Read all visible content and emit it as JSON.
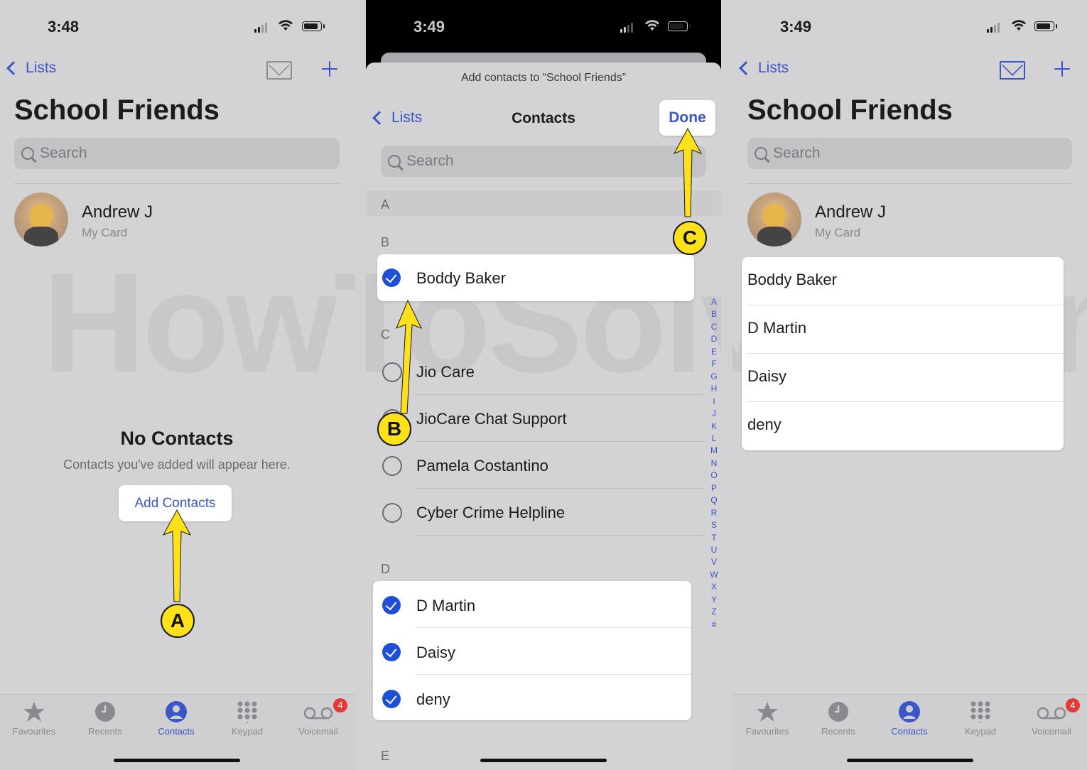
{
  "panel1": {
    "status_time": "3:48",
    "back_label": "Lists",
    "title": "School Friends",
    "search_placeholder": "Search",
    "card_name": "Andrew J",
    "card_sub": "My Card",
    "empty_title": "No Contacts",
    "empty_sub": "Contacts you've added will appear here.",
    "add_button": "Add Contacts",
    "callout": "A"
  },
  "panel2": {
    "status_time": "3:49",
    "sheet_header": "Add contacts to “School Friends”",
    "back_label": "Lists",
    "nav_title": "Contacts",
    "done_label": "Done",
    "search_placeholder": "Search",
    "sections": [
      "A",
      "B",
      "C",
      "D",
      "E"
    ],
    "rows": [
      {
        "name": "Boddy Baker",
        "checked": true
      },
      {
        "name": "Jio Care",
        "checked": false
      },
      {
        "name": "JioCare Chat Support",
        "checked": false
      },
      {
        "name": "Pamela Costantino",
        "checked": false
      },
      {
        "name": "Cyber Crime Helpline",
        "checked": false
      },
      {
        "name": "D Martin",
        "checked": true
      },
      {
        "name": "Daisy",
        "checked": true
      },
      {
        "name": "deny",
        "checked": true
      }
    ],
    "index_letters": [
      "A",
      "B",
      "C",
      "D",
      "E",
      "F",
      "G",
      "H",
      "I",
      "J",
      "K",
      "L",
      "M",
      "N",
      "O",
      "P",
      "Q",
      "R",
      "S",
      "T",
      "U",
      "V",
      "W",
      "X",
      "Y",
      "Z",
      "#"
    ],
    "callout_b": "B",
    "callout_c": "C"
  },
  "panel3": {
    "status_time": "3:49",
    "back_label": "Lists",
    "title": "School Friends",
    "search_placeholder": "Search",
    "card_name": "Andrew J",
    "card_sub": "My Card",
    "members": [
      "Boddy Baker",
      "D Martin",
      "Daisy",
      "deny"
    ]
  },
  "tabbar": {
    "tabs": [
      {
        "label": "Favourites",
        "icon": "star-icon"
      },
      {
        "label": "Recents",
        "icon": "clock-icon"
      },
      {
        "label": "Contacts",
        "icon": "person-circle-icon"
      },
      {
        "label": "Keypad",
        "icon": "keypad-icon"
      },
      {
        "label": "Voicemail",
        "icon": "voicemail-icon"
      }
    ],
    "voicemail_badge": "4"
  },
  "watermark": "HowToSolve.com",
  "colors": {
    "accent": "#3b56c7",
    "check": "#1f4fd6",
    "callout": "#ffe11a",
    "badge": "#e53935"
  }
}
